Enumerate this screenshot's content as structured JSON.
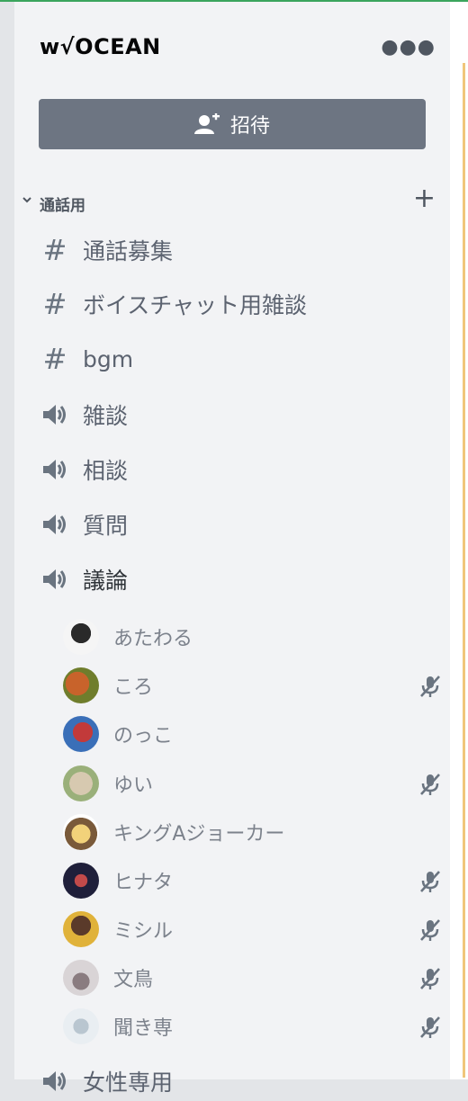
{
  "server": {
    "name": "w√OCEAN",
    "menu_icon": "more-dots-icon"
  },
  "invite": {
    "label": "招待",
    "icon": "add-user-icon"
  },
  "category": {
    "label": "通話用",
    "collapse_icon": "chevron-down-icon",
    "add_icon": "plus-icon"
  },
  "channels": [
    {
      "type": "text",
      "label": "通話募集"
    },
    {
      "type": "text",
      "label": "ボイスチャット用雑談"
    },
    {
      "type": "text",
      "label": "bgm"
    },
    {
      "type": "voice",
      "label": "雑談"
    },
    {
      "type": "voice",
      "label": "相談"
    },
    {
      "type": "voice",
      "label": "質問"
    },
    {
      "type": "voice",
      "label": "議論",
      "active": true
    }
  ],
  "voice_users": [
    {
      "name": "あたわる",
      "muted": false,
      "avatar_colors": [
        "#f5f5f5",
        "#2a2a2a"
      ]
    },
    {
      "name": "ころ",
      "muted": true,
      "avatar_colors": [
        "#c8632b",
        "#6f7d2c"
      ]
    },
    {
      "name": "のっこ",
      "muted": false,
      "avatar_colors": [
        "#3a6fb8",
        "#c23a3a"
      ]
    },
    {
      "name": "ゆい",
      "muted": true,
      "avatar_colors": [
        "#d7c9b0",
        "#9ab07a"
      ]
    },
    {
      "name": "キングAジョーカー",
      "muted": false,
      "avatar_colors": [
        "#f2d27a",
        "#7a5a3a"
      ]
    },
    {
      "name": "ヒナタ",
      "muted": true,
      "avatar_colors": [
        "#1f1f3a",
        "#c24a4a"
      ]
    },
    {
      "name": "ミシル",
      "muted": true,
      "avatar_colors": [
        "#e0b23a",
        "#5a3a2a"
      ]
    },
    {
      "name": "文鳥",
      "muted": true,
      "avatar_colors": [
        "#d9d4d6",
        "#8a7c80"
      ]
    },
    {
      "name": "聞き専",
      "muted": true,
      "avatar_colors": [
        "#e9eef2",
        "#b9c6d0"
      ]
    }
  ],
  "next_channel": {
    "type": "voice",
    "label": "女性専用"
  },
  "colors": {
    "invite_bg": "#6d7582",
    "panel_bg": "#f2f3f5",
    "text": "#5c6370",
    "accent": "#f0c67a"
  }
}
